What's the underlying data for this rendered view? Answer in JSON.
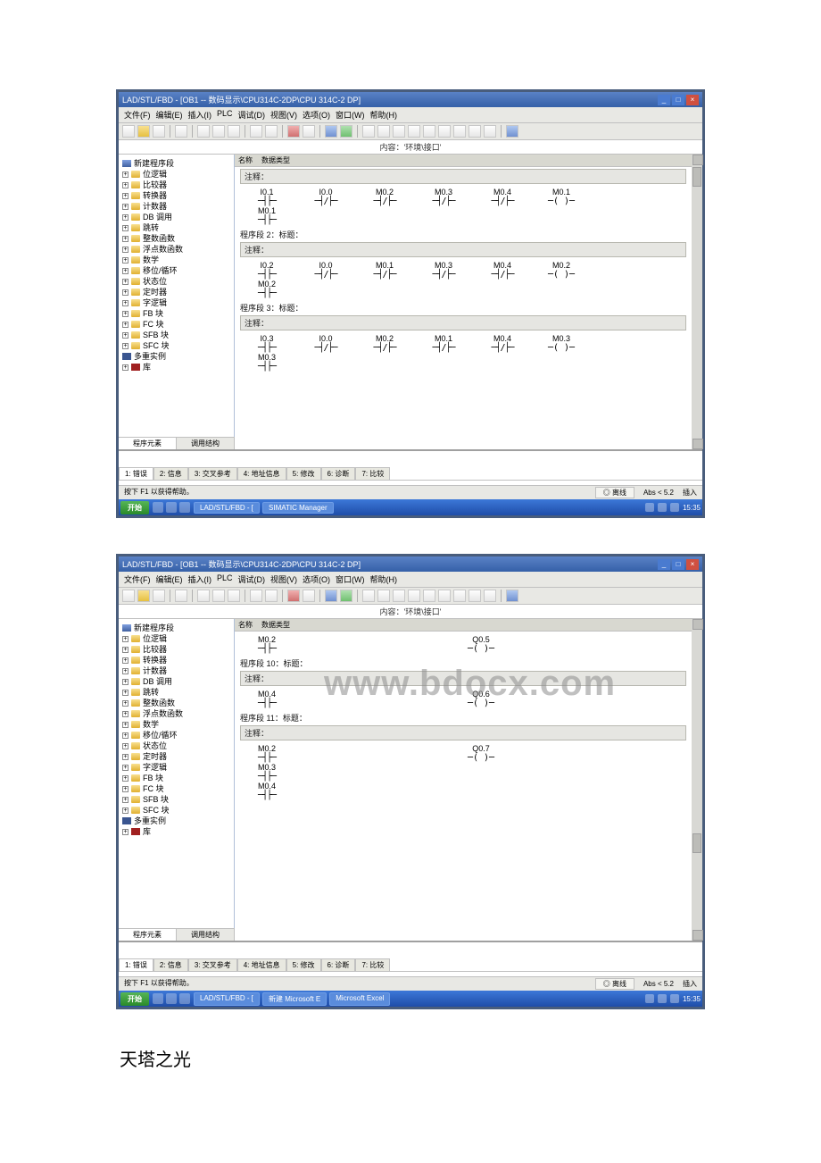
{
  "app": {
    "title": "LAD/STL/FBD - [OB1 -- 数码显示\\CPU314C-2DP\\CPU 314C-2 DP]",
    "menu": [
      "文件(F)",
      "编辑(E)",
      "插入(I)",
      "PLC",
      "调试(D)",
      "视图(V)",
      "选项(O)",
      "窗口(W)",
      "帮助(H)"
    ],
    "path_center": "内容：'环境\\接口'",
    "editor_head": [
      "名称",
      "数据类型"
    ],
    "tree_bottom": [
      "程序元素",
      "调用结构"
    ]
  },
  "status": {
    "help_hint": "按下 F1 以获得帮助。",
    "mid1": "◎ 离线",
    "mid2": "Abs < 5.2",
    "right": "插入"
  },
  "taskbar": {
    "start": "开始",
    "tasks1": [
      "LAD/STL/FBD  - [",
      "SIMATIC Manager"
    ],
    "tasks2": [
      "LAD/STL/FBD  - [",
      "新建 Microsoft E",
      "Microsoft Excel"
    ],
    "time": "15:35"
  },
  "tree": {
    "root": "新建程序段",
    "items": [
      "位逻辑",
      "比较器",
      "转换器",
      "计数器",
      "DB 调用",
      "跳转",
      "整数函数",
      "浮点数函数",
      "数学",
      "移位/循环",
      "状态位",
      "定时器",
      "字逻辑",
      "FB 块",
      "FC 块",
      "SFB 块",
      "SFC 块",
      "多重实例",
      "库"
    ]
  },
  "shot1": {
    "networks": [
      {
        "title": "",
        "comment": "注释：",
        "rows": [
          {
            "labels": [
              "I0.1",
              "I0.0",
              "M0.2",
              "M0.3",
              "M0.4",
              "M0.1"
            ],
            "syms": [
              "─┤├─",
              "─┤/├─",
              "─┤/├─",
              "─┤/├─",
              "─┤/├─",
              "─( )─"
            ]
          },
          {
            "labels": [
              "M0.1"
            ],
            "syms": [
              "─┤├─"
            ]
          }
        ]
      },
      {
        "title": "程序段 2：标题：",
        "comment": "注释：",
        "rows": [
          {
            "labels": [
              "I0.2",
              "I0.0",
              "M0.1",
              "M0.3",
              "M0.4",
              "M0.2"
            ],
            "syms": [
              "─┤├─",
              "─┤/├─",
              "─┤/├─",
              "─┤/├─",
              "─┤/├─",
              "─( )─"
            ]
          },
          {
            "labels": [
              "M0.2"
            ],
            "syms": [
              "─┤├─"
            ]
          }
        ]
      },
      {
        "title": "程序段 3：标题：",
        "comment": "注释：",
        "rows": [
          {
            "labels": [
              "I0.3",
              "I0.0",
              "M0.2",
              "M0.1",
              "M0.4",
              "M0.3"
            ],
            "syms": [
              "─┤├─",
              "─┤/├─",
              "─┤/├─",
              "─┤/├─",
              "─┤/├─",
              "─( )─"
            ]
          },
          {
            "labels": [
              "M0.3"
            ],
            "syms": [
              "─┤├─"
            ]
          }
        ]
      }
    ],
    "output_tabs": [
      "1: 错误",
      "2: 信息",
      "3: 交叉参考",
      "4: 地址信息",
      "5: 修改",
      "6: 诊断",
      "7: 比较"
    ]
  },
  "shot2": {
    "networks": [
      {
        "title": "",
        "comment": "",
        "rows": [
          {
            "labels": [
              "M0.2",
              "Q0.5"
            ],
            "syms": [
              "─┤├─",
              "─( )─"
            ]
          }
        ]
      },
      {
        "title": "程序段 10：标题：",
        "comment": "注释：",
        "rows": [
          {
            "labels": [
              "M0.4",
              "Q0.6"
            ],
            "syms": [
              "─┤├─",
              "─( )─"
            ]
          }
        ]
      },
      {
        "title": "程序段 11：标题：",
        "comment": "注释：",
        "rows": [
          {
            "labels": [
              "M0.2",
              "Q0.7"
            ],
            "syms": [
              "─┤├─",
              "─( )─"
            ]
          },
          {
            "labels": [
              "M0.3"
            ],
            "syms": [
              "─┤├─"
            ]
          },
          {
            "labels": [
              "M0.4"
            ],
            "syms": [
              "─┤├─"
            ]
          }
        ]
      }
    ],
    "output_tabs": [
      "1: 错误",
      "2: 信息",
      "3: 交叉参考",
      "4: 地址信息",
      "5: 修改",
      "6: 诊断",
      "7: 比较"
    ]
  },
  "caption": "天塔之光",
  "watermark": "www.bdocx.com"
}
